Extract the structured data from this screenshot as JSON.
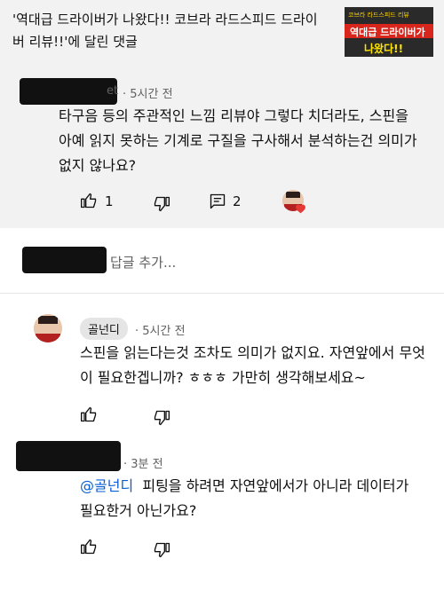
{
  "video": {
    "title": "'역대급 드라이버가 나왔다!! 코브라 라드스피드 드라이버 리뷰!!'에 달린 댓글",
    "thumbnail_top": "코브라 라드스피드 리뷰",
    "thumbnail_band": "역대급 드라이버가",
    "thumbnail_bottom": "나왔다!!"
  },
  "comment": {
    "author_suffix": "et",
    "time": "· 5시간 전",
    "text": "타구음 등의 주관적인 느낌 리뷰야 그렇다 치더라도, 스핀을 아예 읽지 못하는 기계로 구질을 구사해서 분석하는건 의미가 없지 않나요?",
    "likes": "1",
    "replies_count": "2"
  },
  "reply_box": {
    "placeholder": "답글 추가..."
  },
  "replies": [
    {
      "author": "골넌디",
      "time": "· 5시간 전",
      "text": "스핀을 읽는다는것 조차도 의미가 없지요. 자연앞에서 무엇이 필요한겝니까? ㅎㅎㅎ 가만히 생각해보세요~"
    },
    {
      "time": "· 3분 전",
      "mention": "@골넌디",
      "text": "피팅을 하려면 자연앞에서가 아니라 데이터가 필요한거 아닌가요?"
    }
  ],
  "colors": {
    "gray_bg": "#f2f2f2",
    "link": "#065fd4",
    "meta": "#606060"
  }
}
